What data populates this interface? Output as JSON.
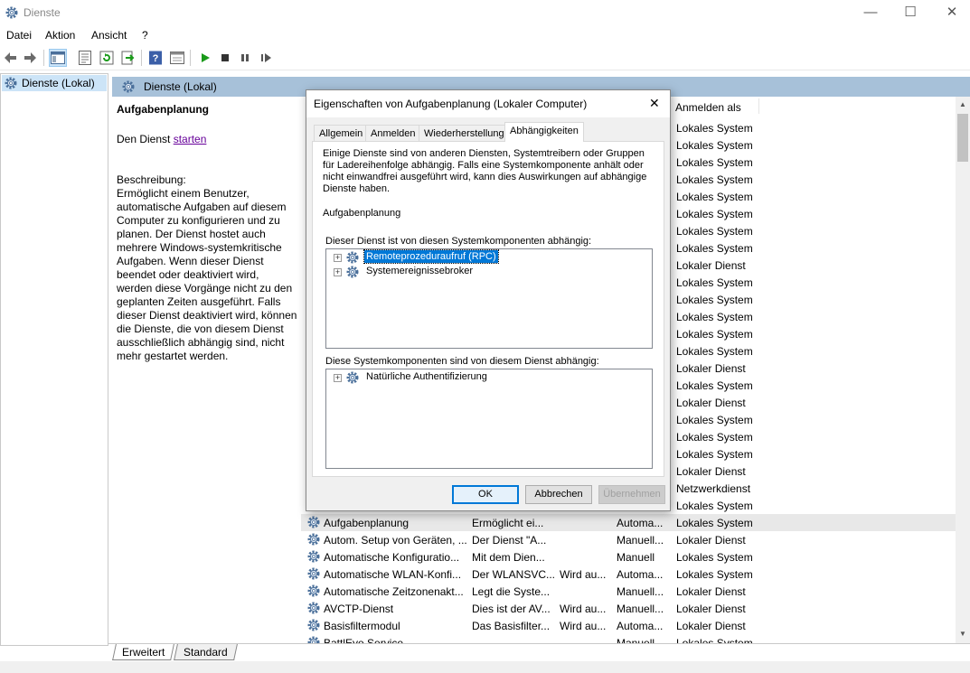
{
  "window": {
    "title": "Dienste",
    "minimize": "—",
    "maximize": "☐",
    "close": "✕"
  },
  "menu": [
    "Datei",
    "Aktion",
    "Ansicht",
    "?"
  ],
  "toolbar_icons": [
    "back-icon",
    "forward-icon",
    "console-tree-icon",
    "properties-icon",
    "refresh-icon",
    "export-icon",
    "help-icon",
    "view-icon",
    "start-service-icon",
    "stop-service-icon",
    "pause-service-icon",
    "restart-service-icon"
  ],
  "tree": {
    "root": "Dienste (Lokal)"
  },
  "pane_header": "Dienste (Lokal)",
  "description": {
    "service_name": "Aufgabenplanung",
    "start_prefix": "Den Dienst ",
    "start_link": "starten",
    "label": "Beschreibung:",
    "text": "Ermöglicht einem Benutzer, automatische Aufgaben auf diesem Computer zu konfigurieren und zu planen. Der Dienst hostet auch mehrere Windows-systemkritische Aufgaben. Wenn dieser Dienst beendet oder deaktiviert wird, werden diese Vorgänge nicht zu den geplanten Zeiten ausgeführt. Falls dieser Dienst deaktiviert wird, können die Dienste, die von diesem Dienst ausschließlich abhängig sind, nicht mehr gestartet werden."
  },
  "list": {
    "column_logon": "Anmelden als",
    "logon_rows": [
      "Lokales System",
      "Lokales System",
      "Lokales System",
      "Lokales System",
      "Lokales System",
      "Lokales System",
      "Lokales System",
      "Lokales System",
      "Lokaler Dienst",
      "Lokales System",
      "Lokales System",
      "Lokales System",
      "Lokales System",
      "Lokales System",
      "Lokaler Dienst",
      "Lokales System",
      "Lokaler Dienst",
      "Lokales System",
      "Lokales System",
      "Lokales System",
      "Lokaler Dienst",
      "Netzwerkdienst",
      "Lokales System"
    ],
    "rows": [
      {
        "name": "Aufgabenplanung",
        "desc": "Ermöglicht ei...",
        "status": "",
        "startup": "Automa...",
        "logon": "Lokales System"
      },
      {
        "name": "Autom. Setup von Geräten, ...",
        "desc": "Der Dienst \"A...",
        "status": "",
        "startup": "Manuell...",
        "logon": "Lokaler Dienst"
      },
      {
        "name": "Automatische Konfiguratio...",
        "desc": "Mit dem Dien...",
        "status": "",
        "startup": "Manuell",
        "logon": "Lokales System"
      },
      {
        "name": "Automatische WLAN-Konfi...",
        "desc": "Der WLANSVC...",
        "status": "Wird au...",
        "startup": "Automa...",
        "logon": "Lokales System"
      },
      {
        "name": "Automatische Zeitzonenakt...",
        "desc": "Legt die Syste...",
        "status": "",
        "startup": "Manuell...",
        "logon": "Lokaler Dienst"
      },
      {
        "name": "AVCTP-Dienst",
        "desc": "Dies ist der AV...",
        "status": "Wird au...",
        "startup": "Manuell...",
        "logon": "Lokaler Dienst"
      },
      {
        "name": "Basisfiltermodul",
        "desc": "Das Basisfilter...",
        "status": "Wird au...",
        "startup": "Automa...",
        "logon": "Lokaler Dienst"
      },
      {
        "name": "BattlEye Service",
        "desc": "",
        "status": "",
        "startup": "Manuell",
        "logon": "Lokales System"
      }
    ]
  },
  "bottom_tabs": [
    "Erweitert",
    "Standard"
  ],
  "dialog": {
    "title": "Eigenschaften von Aufgabenplanung (Lokaler Computer)",
    "close": "✕",
    "tabs": [
      "Allgemein",
      "Anmelden",
      "Wiederherstellung",
      "Abhängigkeiten"
    ],
    "active_tab": "Abhängigkeiten",
    "intro": "Einige Dienste sind von anderen Diensten, Systemtreibern oder Gruppen für Ladereihenfolge abhängig. Falls eine Systemkomponente anhält oder nicht einwandfrei ausgeführt wird, kann dies Auswirkungen auf abhängige Dienste haben.",
    "service_name": "Aufgabenplanung",
    "depends_on_label": "Dieser Dienst ist von diesen Systemkomponenten abhängig:",
    "depends_on": [
      "Remoteprozeduraufruf (RPC)",
      "Systemereignissebroker"
    ],
    "dependents_label": "Diese Systemkomponenten sind von diesem Dienst abhängig:",
    "dependents": [
      "Natürliche Authentifizierung"
    ],
    "ok": "OK",
    "cancel": "Abbrechen",
    "apply": "Übernehmen"
  },
  "colors": {
    "pane_header": "#a7c1d9",
    "selection": "#0078d7",
    "tree_selection": "#cce4f7",
    "link": "#660099",
    "play": "#1a9a1a"
  }
}
